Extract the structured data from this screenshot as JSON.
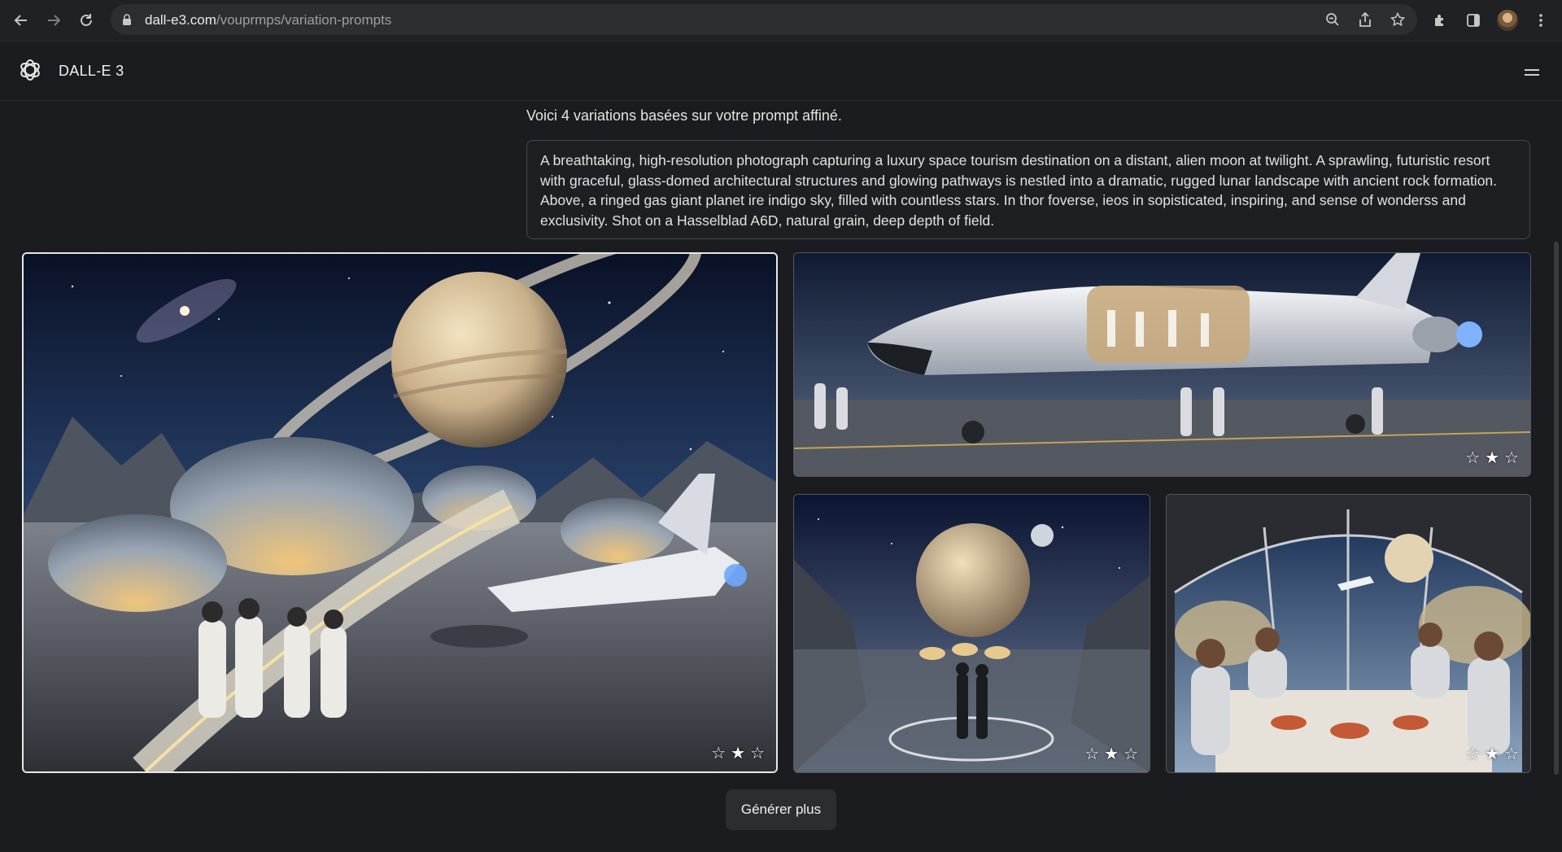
{
  "browser": {
    "url_host": "dall-e3.com",
    "url_path": "/vouprmps/variation-prompts",
    "icons": [
      "back-arrow-icon",
      "forward-arrow-icon",
      "reload-icon",
      "lock-icon",
      "zoom-icon",
      "share-icon",
      "bookmark-star-icon",
      "extensions-icon",
      "side-panel-icon",
      "profile-avatar",
      "kebab-menu-icon"
    ]
  },
  "app": {
    "title": "DALL-E 3"
  },
  "main": {
    "intro": "Voici 4 variations basées sur votre prompt affiné.",
    "prompt": "A breathtaking, high-resolution photograph capturing a luxury space tourism destination on a distant, alien moon at twilight. A sprawling, futuristic resort with graceful, glass-domed architectural structures and glowing pathways is nestled into a dramatic, rugged lunar landscape with ancient rock formation. Above, a ringed gas giant planet ire indigo sky, filled with countless stars. In thor foverse, ieos in sopisticated, inspiring, and sense of wonderss and exclusivity. Shot on a Hasselblad A6D, natural grain, deep depth of field.",
    "images": [
      {
        "description_icon": "lunar-resort-image",
        "rating_icons": [
          "☆",
          "★",
          "☆"
        ]
      },
      {
        "description_icon": "space-shuttle-image",
        "rating_icons": [
          "☆",
          "★",
          "☆"
        ]
      },
      {
        "description_icon": "couple-overlook-image",
        "rating_icons": [
          "☆",
          "★",
          "☆"
        ]
      },
      {
        "description_icon": "dome-dining-image",
        "rating_icons": [
          "☆",
          "★",
          "☆"
        ]
      }
    ],
    "generate_more": "Générer plus"
  },
  "colors": {
    "background": "#1b1c1f",
    "chrome": "#202124",
    "omnibox": "#2d2e31",
    "button": "#2c2d31"
  }
}
